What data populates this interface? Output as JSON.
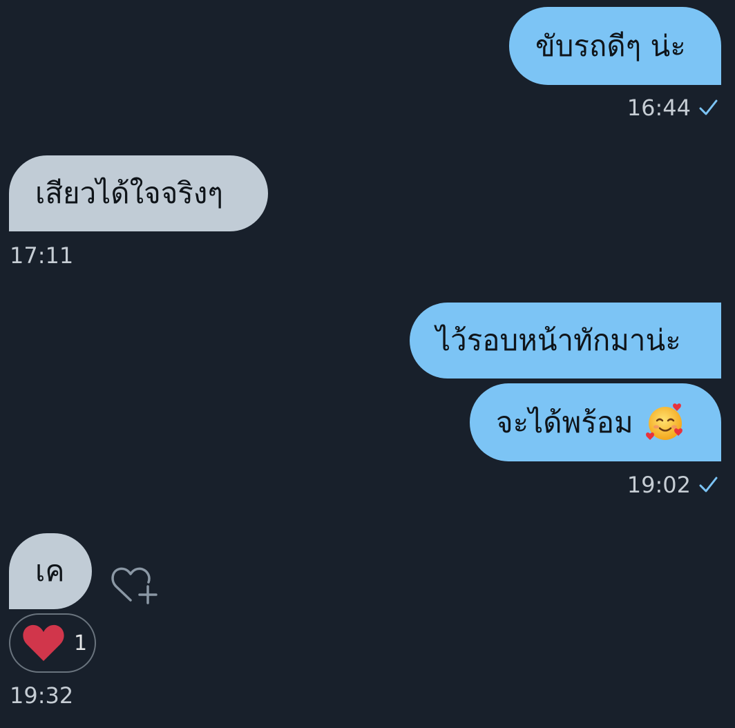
{
  "messages": [
    {
      "direction": "outgoing",
      "text": "ขับรถดีๆ น่ะ"
    },
    {
      "direction": "outgoing",
      "time": "16:44",
      "status_icon": "check-icon"
    },
    {
      "direction": "incoming",
      "text": "เสียวได้ใจจริงๆ",
      "time": "17:11"
    },
    {
      "direction": "outgoing",
      "text": "ไว้รอบหน้าทักมาน่ะ"
    },
    {
      "direction": "outgoing",
      "text": "จะได้พร้อม",
      "emoji": "smiling-face-with-hearts",
      "time": "19:02",
      "status_icon": "check-icon"
    },
    {
      "direction": "incoming",
      "text": "เค",
      "reaction": {
        "icon": "heart-icon",
        "count": "1"
      },
      "time": "19:32"
    }
  ],
  "add_reaction_icon": "heart-plus-icon",
  "colors": {
    "background": "#18202b",
    "outgoing_bubble": "#7cc4f5",
    "incoming_bubble": "#c1ccd6",
    "check": "#7cc4f5",
    "heart": "#d1364b"
  }
}
